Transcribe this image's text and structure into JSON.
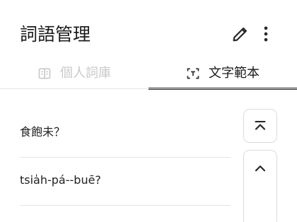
{
  "header": {
    "title": "詞語管理",
    "actions": [
      "edit-icon",
      "more-vert-icon"
    ]
  },
  "tabs": [
    {
      "label": "個人詞庫",
      "icon": "book-icon",
      "state": "inactive"
    },
    {
      "label": "文字範本",
      "icon": "text-scan-icon",
      "state": "selected"
    }
  ],
  "list": {
    "items": [
      {
        "text": "食飽未？"
      },
      {
        "text": "tsia̍h-pá--buē?"
      }
    ]
  },
  "side_controls": {
    "icons": [
      "move-to-top-icon",
      "move-up-icon"
    ]
  },
  "colors": {
    "accent": "#2b2b2b",
    "inactive_tab": "#c9c9c9",
    "divider": "#e3e3e3"
  }
}
